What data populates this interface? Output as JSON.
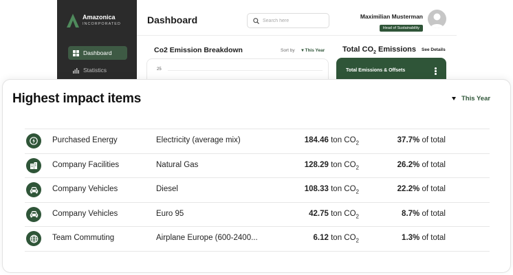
{
  "app": {
    "brand_name": "Amazonica",
    "brand_sub": "INCORPORATED",
    "page_title": "Dashboard"
  },
  "sidebar": {
    "items": [
      {
        "label": "Dashboard",
        "icon": "grid-icon",
        "active": true
      },
      {
        "label": "Statistics",
        "icon": "bar-chart-icon",
        "active": false
      }
    ]
  },
  "search": {
    "placeholder": "Search here"
  },
  "user": {
    "name": "Maximilian Musterman",
    "role": "Head of Sustainability"
  },
  "co2_breakdown": {
    "title": "Co2 Emission Breakdown",
    "sort_label": "Sort by",
    "sort_value": "This Year",
    "tick": "25"
  },
  "total_emissions": {
    "title_prefix": "Total CO",
    "title_sub": "2",
    "title_suffix": " Emissions",
    "see_details": "See Details",
    "card_label": "Total Emissions & Offsets"
  },
  "impact": {
    "title": "Highest impact items",
    "period": "This Year",
    "unit_prefix": "ton CO",
    "unit_sub": "2",
    "pct_suffix": "of total",
    "rows": [
      {
        "icon": "lightning-icon",
        "category": "Purchased Energy",
        "source": "Electricity (average mix)",
        "amount": "184.46",
        "percent": "37.7%"
      },
      {
        "icon": "building-icon",
        "category": "Company Facilities",
        "source": "Natural Gas",
        "amount": "128.29",
        "percent": "26.2%"
      },
      {
        "icon": "car-icon",
        "category": "Company Vehicles",
        "source": "Diesel",
        "amount": "108.33",
        "percent": "22.2%"
      },
      {
        "icon": "car-icon",
        "category": "Company Vehicles",
        "source": "Euro 95",
        "amount": "42.75",
        "percent": "8.7%"
      },
      {
        "icon": "globe-icon",
        "category": "Team Commuting",
        "source": "Airplane Europe (600-2400...",
        "amount": "6.12",
        "percent": "1.3%"
      }
    ]
  },
  "colors": {
    "accent": "#2f5538",
    "sidebar": "#2b2b2b"
  }
}
